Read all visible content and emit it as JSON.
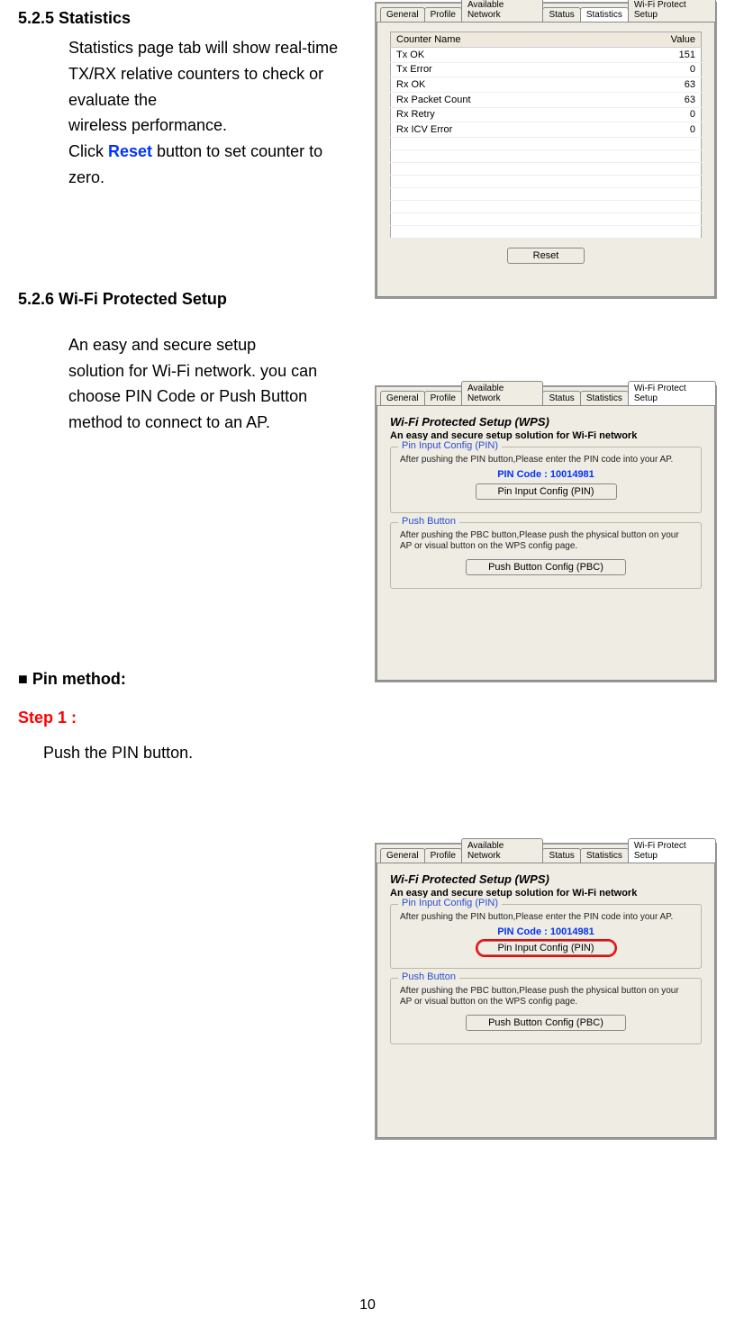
{
  "page_number": "10",
  "section_525": {
    "heading": "5.2.5 Statistics",
    "p1": "Statistics page tab will show real-time TX/RX relative counters to check or evaluate the",
    "p2": "wireless performance.",
    "p3a": "Click ",
    "reset_word": "Reset",
    "p3b": " button to set counter to",
    "p4": "zero."
  },
  "section_526": {
    "heading": "5.2.6 Wi-Fi Protected Setup",
    "p1": "An easy and secure setup",
    "p2": "solution for Wi-Fi network. you can choose PIN Code or Push Button method to connect to an AP."
  },
  "pin_method": {
    "heading": "■ Pin method:",
    "step_label": "Step 1 :",
    "step_text": "Push the PIN button."
  },
  "tabs": {
    "general": "General",
    "profile": "Profile",
    "available": "Available Network",
    "status": "Status",
    "statistics": "Statistics",
    "wps": "Wi-Fi Protect Setup"
  },
  "stats_panel": {
    "col_name": "Counter Name",
    "col_value": "Value",
    "rows": [
      {
        "name": "Tx OK",
        "value": "151"
      },
      {
        "name": "Tx Error",
        "value": "0"
      },
      {
        "name": "Rx OK",
        "value": "63"
      },
      {
        "name": "Rx Packet Count",
        "value": "63"
      },
      {
        "name": "Rx Retry",
        "value": "0"
      },
      {
        "name": "Rx ICV Error",
        "value": "0"
      }
    ],
    "reset_btn": "Reset"
  },
  "wps_panel": {
    "title": "Wi-Fi Protected Setup (WPS)",
    "subtitle": "An easy and secure setup solution for Wi-Fi network",
    "pin_group": {
      "legend": "Pin Input Config (PIN)",
      "desc": "After pushing the PIN button,Please enter the PIN code into your AP.",
      "pin_code": "PIN Code :  10014981",
      "btn": "Pin Input Config (PIN)"
    },
    "pbc_group": {
      "legend": "Push Button",
      "desc": "After pushing the PBC button,Please push the physical button on your AP or visual button on the WPS config page.",
      "btn": "Push Button Config (PBC)"
    }
  }
}
